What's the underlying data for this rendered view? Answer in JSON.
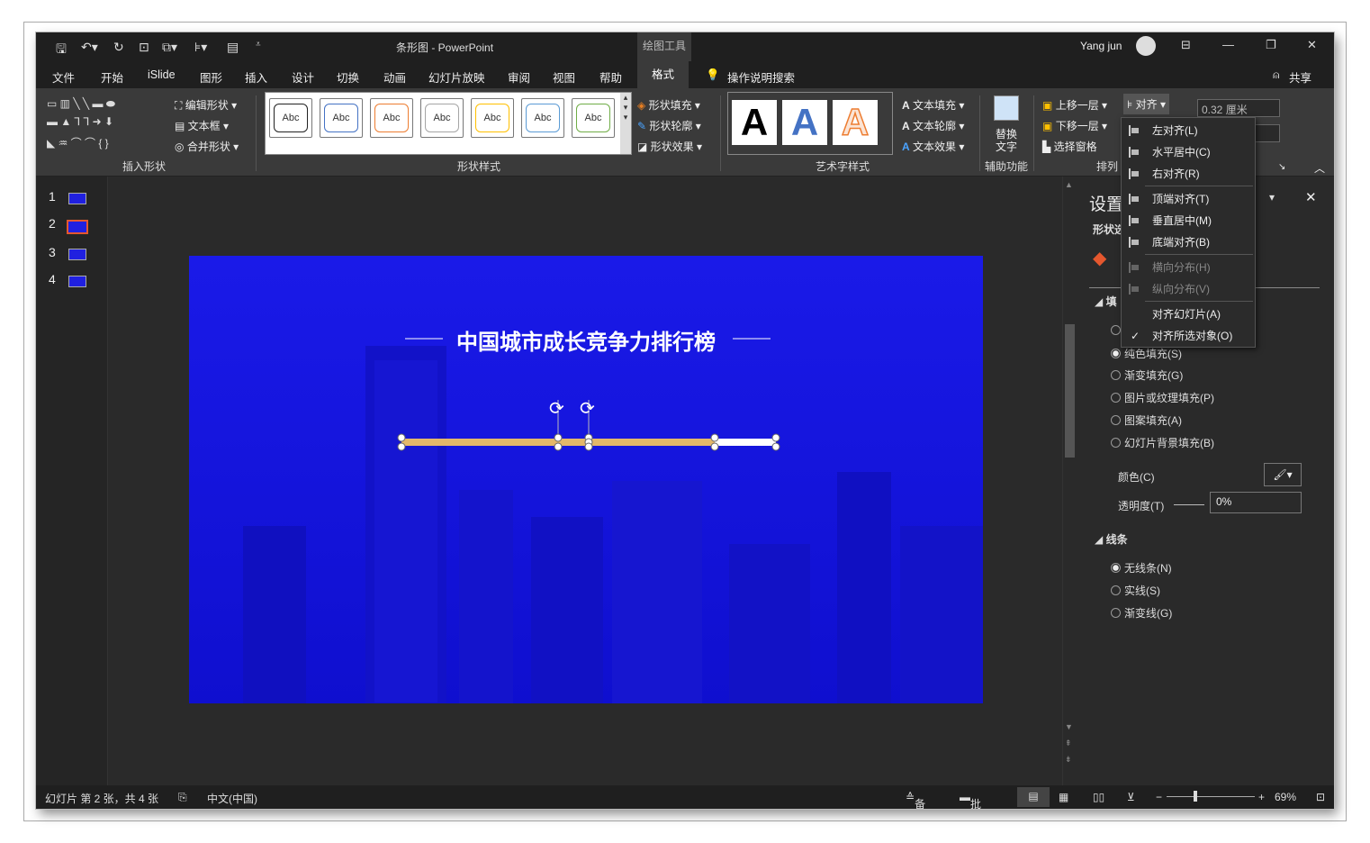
{
  "titlebar": {
    "title": "条形图  -  PowerPoint",
    "context_tab": "绘图工具",
    "user": "Yang jun"
  },
  "tabs": [
    "文件",
    "开始",
    "iSlide",
    "图形",
    "插入",
    "设计",
    "切换",
    "动画",
    "幻灯片放映",
    "审阅",
    "视图",
    "帮助",
    "格式"
  ],
  "active_tab": "格式",
  "tell_me": "操作说明搜索",
  "share": "共享",
  "ribbon": {
    "insert_shapes": {
      "label": "插入形状",
      "edit_shape": "编辑形状",
      "text_box": "文本框",
      "merge_shapes": "合并形状"
    },
    "shape_styles": {
      "label": "形状样式",
      "swatch_text": "Abc",
      "swatch_colors": [
        "#222222",
        "#4472c4",
        "#ed7d31",
        "#a5a5a5",
        "#ffc000",
        "#5b9bd5",
        "#70ad47"
      ],
      "fill": "形状填充",
      "outline": "形状轮廓",
      "effects": "形状效果"
    },
    "wordart": {
      "label": "艺术字样式",
      "letter": "A",
      "text_fill": "文本填充",
      "text_outline": "文本轮廓",
      "text_effects": "文本效果"
    },
    "accessibility": {
      "label": "辅助功能",
      "alt_text_1": "替换",
      "alt_text_2": "文字"
    },
    "arrange": {
      "label": "排列",
      "bring_forward": "上移一层",
      "send_backward": "下移一层",
      "selection_pane": "选择窗格",
      "align": "对齐"
    },
    "size": {
      "height": "0.32 厘米"
    }
  },
  "slides": [
    "1",
    "2",
    "3",
    "4"
  ],
  "current_slide": 2,
  "slide": {
    "title": "中国城市成长竞争力排行榜",
    "accent": "#e3b86a",
    "bg": "#1515e6"
  },
  "align_menu": {
    "items": [
      {
        "label": "左对齐(L)",
        "disabled": false
      },
      {
        "label": "水平居中(C)",
        "disabled": false
      },
      {
        "label": "右对齐(R)",
        "disabled": false
      },
      {
        "label": "顶端对齐(T)",
        "disabled": false
      },
      {
        "label": "垂直居中(M)",
        "disabled": false
      },
      {
        "label": "底端对齐(B)",
        "disabled": false
      },
      {
        "label": "横向分布(H)",
        "disabled": true
      },
      {
        "label": "纵向分布(V)",
        "disabled": true
      },
      {
        "label": "对齐幻灯片(A)",
        "disabled": false
      },
      {
        "label": "对齐所选对象(O)",
        "disabled": false
      }
    ]
  },
  "format_pane": {
    "title": "设置",
    "subtitle": "形状选",
    "fill_header": "填",
    "fill_options": [
      "纯色填充(S)",
      "渐变填充(G)",
      "图片或纹理填充(P)",
      "图案填充(A)",
      "幻灯片背景填充(B)"
    ],
    "color_label": "颜色(C)",
    "transparency_label": "透明度(T)",
    "transparency_value": "0%",
    "line_header": "线条",
    "line_options": [
      "无线条(N)",
      "实线(S)",
      "渐变线(G)"
    ]
  },
  "status": {
    "slide_info": "幻灯片 第 2 张，共 4 张",
    "language": "中文(中国)",
    "notes": "备注",
    "comments": "批注",
    "zoom": "69%"
  }
}
